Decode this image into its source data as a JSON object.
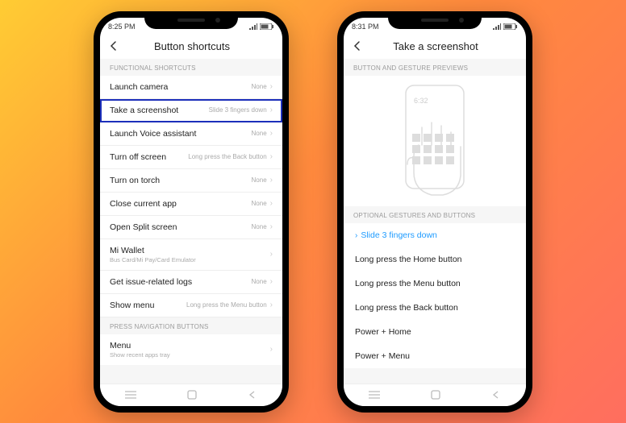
{
  "phone1": {
    "status_time": "8:25 PM",
    "header_title": "Button  shortcuts",
    "section1": "FUNCTIONAL SHORTCUTS",
    "rows": [
      {
        "label": "Launch camera",
        "value": "None"
      },
      {
        "label": "Take a screenshot",
        "value": "Slide 3 fingers down",
        "highlight": true
      },
      {
        "label": "Launch Voice assistant",
        "value": "None"
      },
      {
        "label": "Turn off screen",
        "value": "Long press the Back button"
      },
      {
        "label": "Turn on torch",
        "value": "None"
      },
      {
        "label": "Close current app",
        "value": "None"
      },
      {
        "label": "Open Split screen",
        "value": "None"
      },
      {
        "label": "Mi Wallet",
        "sub": "Bus Card/Mi Pay/Card Emulator",
        "value": ""
      },
      {
        "label": "Get issue-related logs",
        "value": "None"
      },
      {
        "label": "Show menu",
        "value": "Long press the Menu button"
      }
    ],
    "section2": "PRESS NAVIGATION BUTTONS",
    "rows2": [
      {
        "label": "Menu",
        "sub": "Show recent apps tray",
        "value": ""
      }
    ]
  },
  "phone2": {
    "status_time": "8:31 PM",
    "header_title": "Take a screenshot",
    "section1": "BUTTON AND GESTURE PREVIEWS",
    "preview_time": "6:32",
    "section2": "OPTIONAL GESTURES AND BUTTONS",
    "options": [
      {
        "label": "Slide 3 fingers down",
        "selected": true
      },
      {
        "label": "Long press the Home button"
      },
      {
        "label": "Long press the Menu button"
      },
      {
        "label": "Long press the Back button"
      },
      {
        "label": "Power + Home"
      },
      {
        "label": "Power + Menu"
      }
    ]
  }
}
